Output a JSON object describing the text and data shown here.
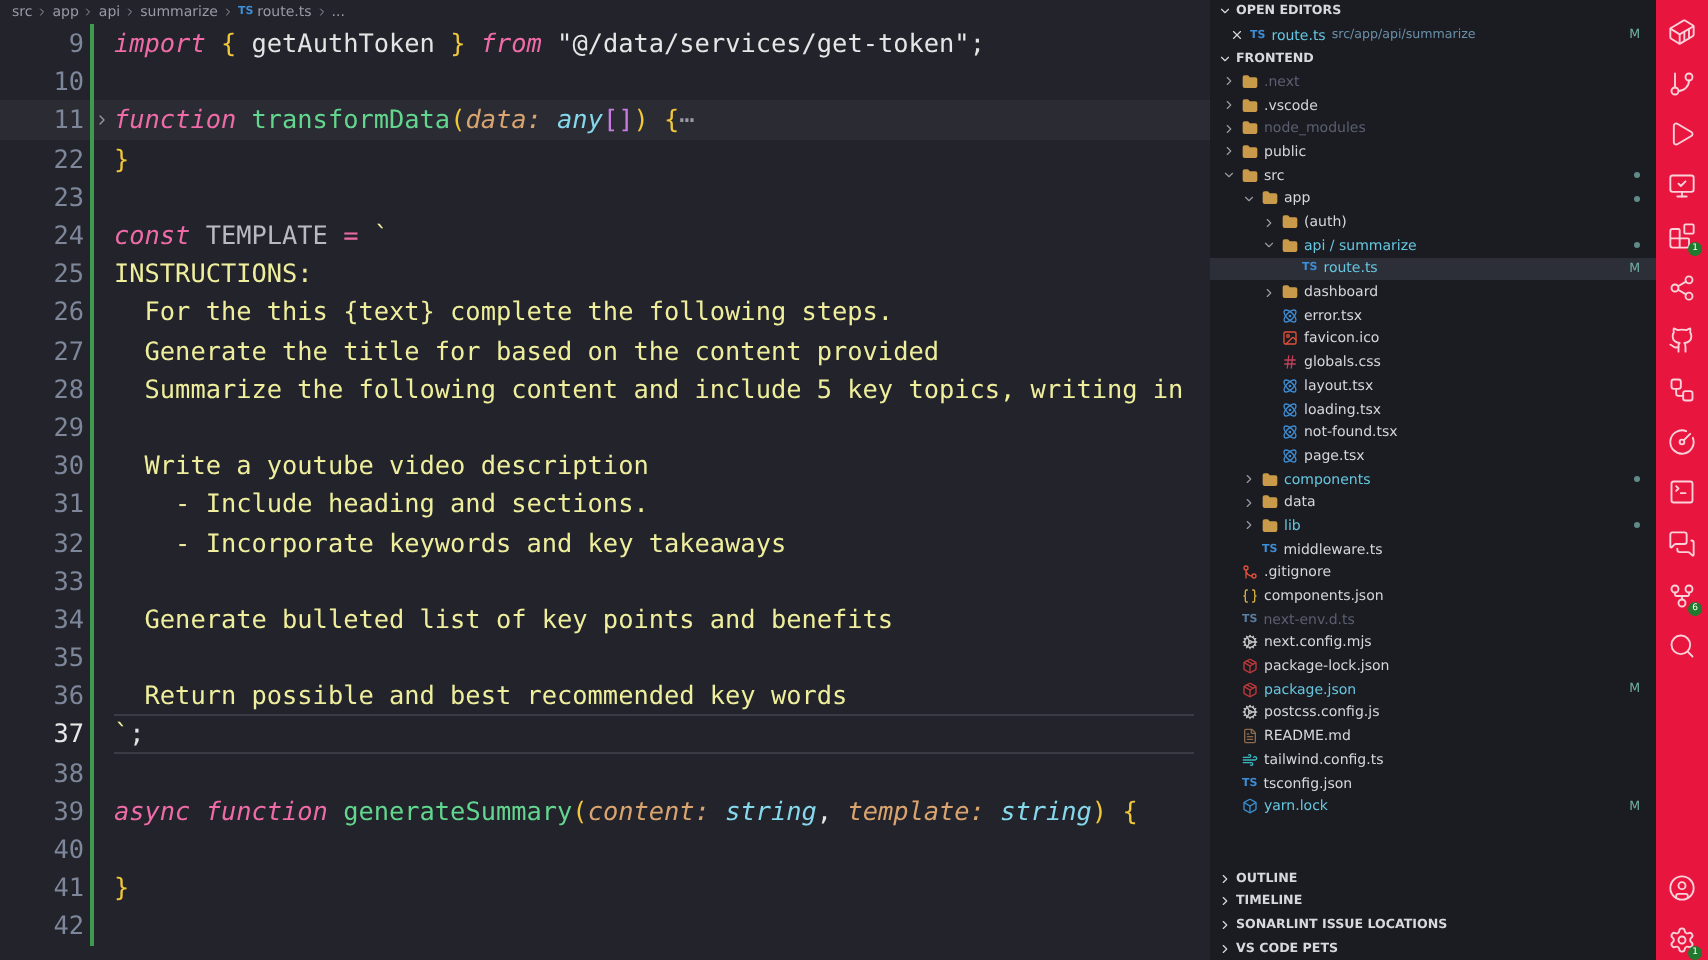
{
  "breadcrumb": [
    {
      "label": "src"
    },
    {
      "label": "app"
    },
    {
      "label": "api"
    },
    {
      "label": "summarize"
    },
    {
      "label": "route.ts",
      "icon_text": "TS"
    },
    {
      "label": "..."
    }
  ],
  "editor": {
    "lines": [
      {
        "number": "9",
        "current": false,
        "tokens": [
          {
            "text": "import",
            "kind": "keyword"
          },
          {
            "text": " {",
            "kind": "brace"
          },
          {
            "text": " getAuthToken ",
            "kind": "plain"
          },
          {
            "text": "}",
            "kind": "brace"
          },
          {
            "text": " from",
            "kind": "keyword"
          },
          {
            "text": " \"@/data/services/get-token\"",
            "kind": "string"
          },
          {
            "text": ";",
            "kind": "plain"
          }
        ]
      },
      {
        "number": "10",
        "current": false
      },
      {
        "number": "11",
        "current": false,
        "folded": true,
        "tokens": [
          {
            "text": "function",
            "kind": "keyword"
          },
          {
            "text": " transformData",
            "kind": "func"
          },
          {
            "text": "(",
            "kind": "brace"
          },
          {
            "text": "data: ",
            "kind": "param"
          },
          {
            "text": "any",
            "kind": "type"
          },
          {
            "text": "[]",
            "kind": "bracket"
          },
          {
            "text": ")",
            "kind": "brace"
          },
          {
            "text": " {",
            "kind": "brace"
          },
          {
            "text": "⋯",
            "kind": "fold"
          }
        ]
      },
      {
        "number": "22",
        "current": false,
        "tokens": [
          {
            "text": "}",
            "kind": "brace"
          }
        ]
      },
      {
        "number": "23",
        "current": false
      },
      {
        "number": "24",
        "current": false,
        "tokens": [
          {
            "text": "const",
            "kind": "keyword"
          },
          {
            "text": " TEMPLATE ",
            "kind": "variable"
          },
          {
            "text": "=",
            "kind": "operator"
          },
          {
            "text": " `",
            "kind": "template"
          }
        ]
      },
      {
        "number": "25",
        "current": false,
        "tokens": [
          {
            "text": "INSTRUCTIONS:",
            "kind": "template"
          }
        ]
      },
      {
        "number": "26",
        "current": false,
        "tokens": [
          {
            "text": "  For the this {text} complete the following steps.",
            "kind": "template"
          }
        ]
      },
      {
        "number": "27",
        "current": false,
        "tokens": [
          {
            "text": "  Generate the title for based on the content provided",
            "kind": "template"
          }
        ]
      },
      {
        "number": "28",
        "current": false,
        "tokens": [
          {
            "text": "  Summarize the following content and include 5 key topics, writing in",
            "kind": "template"
          }
        ]
      },
      {
        "number": "29",
        "current": false
      },
      {
        "number": "30",
        "current": false,
        "tokens": [
          {
            "text": "  Write a youtube video description",
            "kind": "template"
          }
        ]
      },
      {
        "number": "31",
        "current": false,
        "tokens": [
          {
            "text": "    - Include heading and sections.",
            "kind": "template"
          }
        ]
      },
      {
        "number": "32",
        "current": false,
        "tokens": [
          {
            "text": "    - Incorporate keywords and key takeaways",
            "kind": "template"
          }
        ]
      },
      {
        "number": "33",
        "current": false
      },
      {
        "number": "34",
        "current": false,
        "tokens": [
          {
            "text": "  Generate bulleted list of key points and benefits",
            "kind": "template"
          }
        ]
      },
      {
        "number": "35",
        "current": false
      },
      {
        "number": "36",
        "current": false,
        "tokens": [
          {
            "text": "  Return possible and best recommended key words",
            "kind": "template"
          }
        ]
      },
      {
        "number": "37",
        "current": true,
        "tokens": [
          {
            "text": "`",
            "kind": "template"
          },
          {
            "text": ";",
            "kind": "plain"
          }
        ]
      },
      {
        "number": "38",
        "current": false
      },
      {
        "number": "39",
        "current": false,
        "tokens": [
          {
            "text": "async",
            "kind": "keyword"
          },
          {
            "text": " function",
            "kind": "keyword"
          },
          {
            "text": " generateSummary",
            "kind": "func"
          },
          {
            "text": "(",
            "kind": "brace"
          },
          {
            "text": "content: ",
            "kind": "param"
          },
          {
            "text": "string",
            "kind": "type"
          },
          {
            "text": ", ",
            "kind": "plain"
          },
          {
            "text": "template: ",
            "kind": "param"
          },
          {
            "text": "string",
            "kind": "type"
          },
          {
            "text": ")",
            "kind": "brace"
          },
          {
            "text": " {",
            "kind": "brace"
          }
        ]
      },
      {
        "number": "40",
        "current": false
      },
      {
        "number": "41",
        "current": false,
        "tokens": [
          {
            "text": "}",
            "kind": "brace"
          }
        ]
      },
      {
        "number": "42",
        "current": false
      }
    ]
  },
  "explorer": {
    "open_editors": {
      "title": "OPEN EDITORS",
      "expanded": true,
      "items": [
        {
          "label": "route.ts",
          "kind": "typescript",
          "icon_text": "TS",
          "path": "src/app/api/summarize",
          "badge": "M",
          "modified": true,
          "ignored": false
        }
      ]
    },
    "project": {
      "title": "FRONTEND",
      "expanded": true,
      "items": [
        {
          "label": ".next",
          "kind": "folder",
          "modified": false,
          "ignored": true,
          "selected": false,
          "expanded": false
        },
        {
          "label": ".vscode",
          "kind": "folder",
          "modified": false,
          "ignored": false,
          "selected": false,
          "expanded": false
        },
        {
          "label": "node_modules",
          "kind": "folder",
          "modified": false,
          "ignored": true,
          "selected": false,
          "expanded": false
        },
        {
          "label": "public",
          "kind": "folder",
          "modified": false,
          "ignored": false,
          "selected": false,
          "expanded": false
        },
        {
          "label": "src",
          "kind": "folder",
          "modified": false,
          "ignored": false,
          "selected": false,
          "expanded": true,
          "dot": true,
          "children": [
            {
              "label": "app",
              "kind": "folder",
              "modified": false,
              "ignored": false,
              "selected": false,
              "expanded": true,
              "dot": true,
              "children": [
                {
                  "label": "(auth)",
                  "kind": "folder",
                  "modified": false,
                  "ignored": false,
                  "selected": false,
                  "expanded": false
                },
                {
                  "label": "api / summarize",
                  "kind": "folder",
                  "modified": true,
                  "ignored": false,
                  "selected": false,
                  "expanded": true,
                  "dot": true,
                  "children": [
                    {
                      "label": "route.ts",
                      "icon_text": "TS",
                      "kind": "typescript",
                      "modified": true,
                      "ignored": false,
                      "selected": true,
                      "badge": "M"
                    }
                  ]
                },
                {
                  "label": "dashboard",
                  "kind": "folder",
                  "modified": false,
                  "ignored": false,
                  "selected": false,
                  "expanded": false
                },
                {
                  "label": "error.tsx",
                  "kind": "react",
                  "modified": false,
                  "ignored": false,
                  "selected": false
                },
                {
                  "label": "favicon.ico",
                  "kind": "image",
                  "modified": false,
                  "ignored": false,
                  "selected": false
                },
                {
                  "label": "globals.css",
                  "kind": "css",
                  "modified": false,
                  "ignored": false,
                  "selected": false
                },
                {
                  "label": "layout.tsx",
                  "kind": "react",
                  "modified": false,
                  "ignored": false,
                  "selected": false
                },
                {
                  "label": "loading.tsx",
                  "kind": "react",
                  "modified": false,
                  "ignored": false,
                  "selected": false
                },
                {
                  "label": "not-found.tsx",
                  "kind": "react",
                  "modified": false,
                  "ignored": false,
                  "selected": false
                },
                {
                  "label": "page.tsx",
                  "kind": "react",
                  "modified": false,
                  "ignored": false,
                  "selected": false
                }
              ]
            },
            {
              "label": "components",
              "kind": "folder",
              "modified": true,
              "ignored": false,
              "selected": false,
              "expanded": false,
              "dot": true
            },
            {
              "label": "data",
              "kind": "folder",
              "modified": false,
              "ignored": false,
              "selected": false,
              "expanded": false
            },
            {
              "label": "lib",
              "kind": "folder",
              "modified": true,
              "ignored": false,
              "selected": false,
              "expanded": false,
              "dot": true
            },
            {
              "label": "middleware.ts",
              "icon_text": "TS",
              "kind": "typescript",
              "modified": false,
              "ignored": false,
              "selected": false
            }
          ]
        },
        {
          "label": ".gitignore",
          "kind": "git",
          "modified": false,
          "ignored": false,
          "selected": false
        },
        {
          "label": "components.json",
          "kind": "json",
          "modified": false,
          "ignored": false,
          "selected": false
        },
        {
          "label": "next-env.d.ts",
          "icon_text": "TS",
          "kind": "typescript",
          "modified": false,
          "ignored": true,
          "selected": false
        },
        {
          "label": "next.config.mjs",
          "kind": "config",
          "modified": false,
          "ignored": false,
          "selected": false
        },
        {
          "label": "package-lock.json",
          "kind": "npm",
          "modified": false,
          "ignored": false,
          "selected": false
        },
        {
          "label": "package.json",
          "kind": "npm",
          "modified": true,
          "ignored": false,
          "selected": false,
          "badge": "M"
        },
        {
          "label": "postcss.config.js",
          "kind": "config",
          "modified": false,
          "ignored": false,
          "selected": false
        },
        {
          "label": "README.md",
          "kind": "markdown",
          "modified": false,
          "ignored": false,
          "selected": false
        },
        {
          "label": "tailwind.config.ts",
          "kind": "tailwind",
          "modified": false,
          "ignored": false,
          "selected": false
        },
        {
          "label": "tsconfig.json",
          "icon_text": "TS",
          "kind": "typescript",
          "modified": false,
          "ignored": false,
          "selected": false
        },
        {
          "label": "yarn.lock",
          "kind": "yarn",
          "modified": true,
          "ignored": false,
          "selected": false,
          "badge": "M"
        }
      ]
    },
    "sections": [
      {
        "title": "OUTLINE",
        "expanded": false
      },
      {
        "title": "TIMELINE",
        "expanded": false
      },
      {
        "title": "SONARLINT ISSUE LOCATIONS",
        "expanded": false
      },
      {
        "title": "VS CODE PETS",
        "expanded": false
      }
    ]
  },
  "activity_bar": {
    "top": [
      {
        "kind": "container"
      },
      {
        "kind": "branch"
      },
      {
        "kind": "run"
      },
      {
        "kind": "remote"
      },
      {
        "kind": "extensions",
        "badge": "1"
      },
      {
        "kind": "share"
      },
      {
        "kind": "cat"
      },
      {
        "kind": "flow"
      },
      {
        "kind": "gauge"
      },
      {
        "kind": "terminal"
      },
      {
        "kind": "comments"
      },
      {
        "kind": "graph",
        "badge": "6"
      },
      {
        "kind": "search"
      }
    ],
    "bottom": [
      {
        "kind": "account"
      },
      {
        "kind": "settings",
        "badge": "1"
      }
    ]
  }
}
